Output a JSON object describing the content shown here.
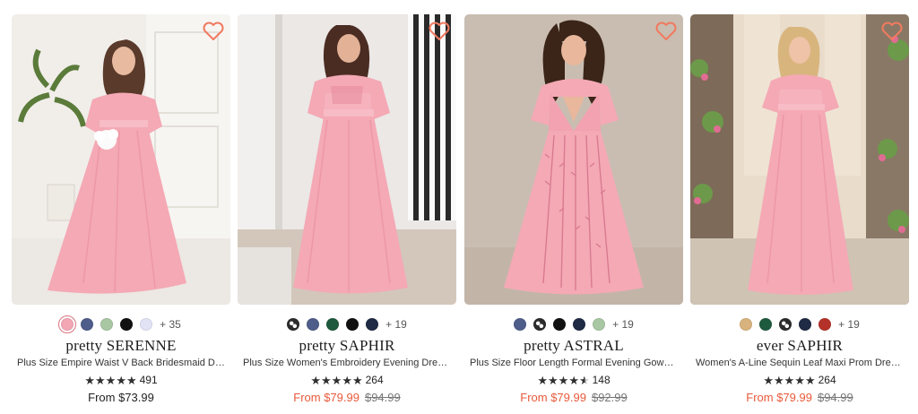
{
  "colors": {
    "sale": "#e8593a",
    "heart": "#f07a60",
    "dress": "#f4a9b5"
  },
  "products": [
    {
      "brand": "pretty SERENNE",
      "title": "Plus Size Empire Waist V Back Bridesmaid Dress...",
      "rating_value": 5,
      "reviews": "491",
      "price_from": "From $73.99",
      "price_original": "",
      "swatches": [
        "#f3a7b5",
        "#4f5d8a",
        "#a9c7a3",
        "#111111",
        "#e2e4f6"
      ],
      "swatch_selected": 0,
      "more_colors": "+ 35",
      "image_icon": "dress-photo"
    },
    {
      "brand": "pretty SAPHIR",
      "title": "Plus Size Women's Embroidery Evening Dresses...",
      "rating_value": 5,
      "reviews": "264",
      "price_from": "From $79.99",
      "price_original": "$94.99",
      "swatches": [
        "pattern",
        "#4f5d8a",
        "#1d5a3e",
        "#111111",
        "#1f2a44"
      ],
      "swatch_selected": -1,
      "more_colors": "+ 19",
      "image_icon": "dress-photo"
    },
    {
      "brand": "pretty ASTRAL",
      "title": "Plus Size Floor Length Formal Evening Gowns fo...",
      "rating_value": 4.5,
      "reviews": "148",
      "price_from": "From $79.99",
      "price_original": "$92.99",
      "swatches": [
        "#4f5d8a",
        "pattern",
        "#111111",
        "#1f2a44",
        "#a9c7a3"
      ],
      "swatch_selected": -1,
      "more_colors": "+ 19",
      "image_icon": "dress-photo"
    },
    {
      "brand": "ever SAPHIR",
      "title": "Women's A-Line Sequin Leaf Maxi Prom Dress...",
      "rating_value": 5,
      "reviews": "264",
      "price_from": "From $79.99",
      "price_original": "$94.99",
      "swatches": [
        "#d9b37d",
        "#1d5a3e",
        "pattern",
        "#1f2a44",
        "#b5322a"
      ],
      "swatch_selected": -1,
      "more_colors": "+ 19",
      "image_icon": "dress-photo"
    }
  ]
}
